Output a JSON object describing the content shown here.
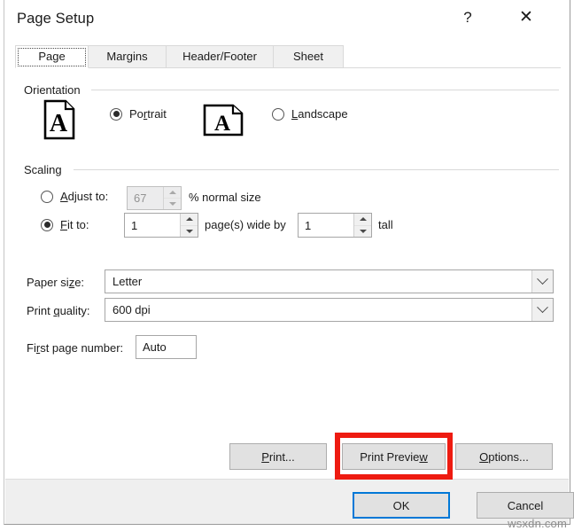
{
  "window": {
    "title": "Page Setup",
    "help_icon": "?",
    "close_icon": "✕"
  },
  "tabs": [
    {
      "label": "Page",
      "active": true
    },
    {
      "label": "Margins",
      "active": false
    },
    {
      "label": "Header/Footer",
      "active": false
    },
    {
      "label": "Sheet",
      "active": false
    }
  ],
  "orientation": {
    "group_label": "Orientation",
    "portrait": {
      "label_pre": "Po",
      "label_key": "r",
      "label_post": "trait",
      "selected": true,
      "icon": "portrait-page-icon"
    },
    "landscape": {
      "label_pre": "",
      "label_key": "L",
      "label_post": "andscape",
      "selected": false,
      "icon": "landscape-page-icon"
    }
  },
  "scaling": {
    "group_label": "Scaling",
    "adjust_to": {
      "label_pre": "",
      "label_key": "A",
      "label_post": "djust to:",
      "selected": false,
      "value": "67",
      "enabled": false,
      "suffix": "% normal size"
    },
    "fit_to": {
      "label_pre": "",
      "label_key": "F",
      "label_post": "it to:",
      "selected": true,
      "wide_value": "1",
      "middle_text": "page(s) wide by",
      "tall_value": "1",
      "suffix": "tall"
    }
  },
  "paper_size": {
    "label_pre": "Paper si",
    "label_key": "z",
    "label_post": "e:",
    "value": "Letter"
  },
  "print_quality": {
    "label_pre": "Print ",
    "label_key": "q",
    "label_post": "uality:",
    "value": "600 dpi"
  },
  "first_page_number": {
    "label_pre": "Fi",
    "label_key": "r",
    "label_post": "st page number:",
    "value": "Auto"
  },
  "action_buttons": {
    "print": {
      "label_pre": "",
      "label_key": "P",
      "label_post": "rint..."
    },
    "print_preview": {
      "label_pre": "Print Previe",
      "label_key": "w",
      "label_post": "",
      "highlighted": true
    },
    "options": {
      "label_pre": "",
      "label_key": "O",
      "label_post": "ptions..."
    }
  },
  "footer_buttons": {
    "ok": {
      "label": "OK",
      "default": true
    },
    "cancel": {
      "label": "Cancel",
      "default": false
    }
  },
  "watermark": {
    "text": "wsxdn.com"
  },
  "colors": {
    "annotation": "#ee1b11",
    "focus_blue": "#0078d7",
    "dialog_bg": "#ffffff",
    "footer_bg": "#efefef",
    "control_bg": "#e1e1e1"
  }
}
